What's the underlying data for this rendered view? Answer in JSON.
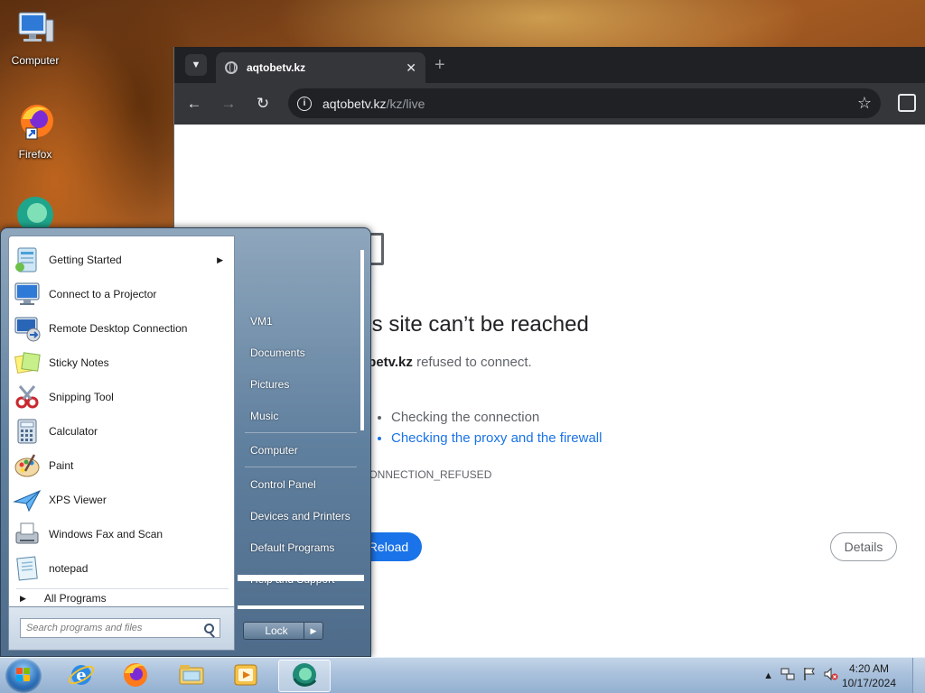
{
  "desktop": {
    "icons": [
      {
        "label": "Computer",
        "icon": "computer-icon"
      },
      {
        "label": "Firefox",
        "icon": "firefox-icon"
      },
      {
        "label": "",
        "icon": "edge-icon"
      }
    ]
  },
  "browser": {
    "tab_title": "aqtobetv.kz",
    "url_host": "aqtobetv.kz",
    "url_path": "/kz/live",
    "error": {
      "title": "his site can’t be reached",
      "host": "tobetv.kz",
      "message": " refused to connect.",
      "try_label": ":",
      "suggestions": [
        "Checking the connection",
        "Checking the proxy and the firewall"
      ],
      "code": "_CONNECTION_REFUSED",
      "reload_label": "Reload",
      "details_label": "Details"
    }
  },
  "start_menu": {
    "programs": [
      {
        "label": "Getting Started",
        "icon": "getting-started-icon",
        "has_submenu": true
      },
      {
        "label": "Connect to a Projector",
        "icon": "projector-icon",
        "has_submenu": false
      },
      {
        "label": "Remote Desktop Connection",
        "icon": "remote-desktop-icon",
        "has_submenu": false
      },
      {
        "label": "Sticky Notes",
        "icon": "sticky-notes-icon",
        "has_submenu": false
      },
      {
        "label": "Snipping Tool",
        "icon": "snipping-tool-icon",
        "has_submenu": false
      },
      {
        "label": "Calculator",
        "icon": "calculator-icon",
        "has_submenu": false
      },
      {
        "label": "Paint",
        "icon": "paint-icon",
        "has_submenu": false
      },
      {
        "label": "XPS Viewer",
        "icon": "xps-viewer-icon",
        "has_submenu": false
      },
      {
        "label": "Windows Fax and Scan",
        "icon": "fax-scan-icon",
        "has_submenu": false
      },
      {
        "label": "notepad",
        "icon": "notepad-icon",
        "has_submenu": false
      }
    ],
    "all_programs_label": "All Programs",
    "search_placeholder": "Search programs and files",
    "right_items": [
      "VM1",
      "Documents",
      "Pictures",
      "Music",
      "Computer",
      "Control Panel",
      "Devices and Printers",
      "Default Programs",
      "Help and Support"
    ],
    "lock_label": "Lock"
  },
  "taskbar": {
    "pinned": [
      "ie-icon",
      "firefox-icon",
      "explorer-icon",
      "media-player-icon",
      "edge-icon"
    ],
    "clock_time": "4:20 AM",
    "clock_date": "10/17/2024"
  }
}
